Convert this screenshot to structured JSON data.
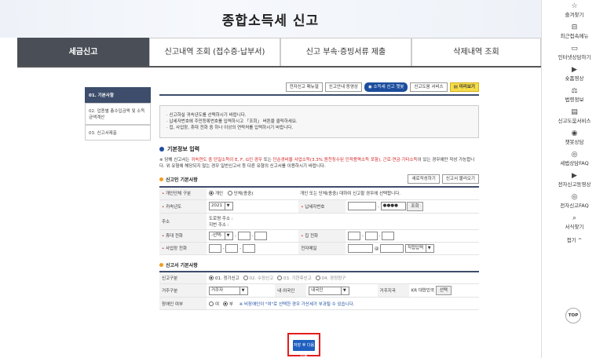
{
  "page": {
    "title": "종합소득세 신고"
  },
  "tabs": [
    {
      "label": "세금신고"
    },
    {
      "label": "신고내역 조회 (접수증·납부서)"
    },
    {
      "label": "신고 부속·증빙서류 제출"
    },
    {
      "label": "삭제내역 조회"
    }
  ],
  "quick": [
    {
      "icon": "star-icon",
      "glyph": "☆",
      "label": "즐겨찾기"
    },
    {
      "icon": "recent-menu-icon",
      "glyph": "⊟",
      "label": "최근접속메뉴"
    },
    {
      "icon": "monitor-icon",
      "glyph": "▭",
      "label": "인터넷상담하기"
    },
    {
      "icon": "video-icon",
      "glyph": "▶",
      "label": "숏폼영상"
    },
    {
      "icon": "law-icon",
      "glyph": "⚖",
      "label": "법령정보"
    },
    {
      "icon": "service-icon",
      "glyph": "▤",
      "label": "신고도움서비스"
    },
    {
      "icon": "chatbot-icon",
      "glyph": "◉",
      "label": "챗봇상담"
    },
    {
      "icon": "faq-icon",
      "glyph": "◎",
      "label": "세법상담FAQ"
    },
    {
      "icon": "video2-icon",
      "glyph": "▶",
      "label": "전자신고동영상"
    },
    {
      "icon": "faq2-icon",
      "glyph": "◎",
      "label": "전자신고FAQ"
    },
    {
      "icon": "search-icon",
      "glyph": "⌕",
      "label": "서식찾기"
    },
    {
      "icon": "fold-icon",
      "glyph": "",
      "label": "접기 ^"
    }
  ],
  "top_label": "TOP",
  "sidenav": [
    {
      "label": "01. 기본사항",
      "active": true
    },
    {
      "label": "02. 업종별 총수입금액 및 소득금액계산",
      "active": false
    },
    {
      "label": "03. 신고서제출",
      "active": false
    }
  ],
  "toolbar": {
    "manual": "전자신고 매뉴얼",
    "guide_video": "신고안내 동영상",
    "chatbot": "소득세 신고 챗봇",
    "help_service": "신고도움 서비스",
    "preview": "미리보기"
  },
  "notice": [
    "· 신고하실 귀속년도를 선택하시기 바랍니다.",
    "· 납세자번호에 주민등록번호를 입력하시고 「조회」 버튼을 클릭하세요.",
    "· 집, 사업장, 휴대 전화 중 하나 이상의 연락처를 입력하시기 바랍니다."
  ],
  "section_basic": "기본정보 입력",
  "warn": {
    "prefix": "※ 당해 신고서는 ",
    "red1": "귀속연도 중 단일소득이 E, F, G인 경우",
    "mid": " 또는 ",
    "red2": "단순경비율 사업소득(3.3% 원천징수된 인적용역소득 포함), 근로·연금·기타소득",
    "suffix": "이 있는 경우에만 작성 가능합니다. 위 유형에 해당되지 않는 경우 일반신고서 등 다른 유형의 신고서를 이용하시기 바랍니다."
  },
  "filer": {
    "heading": "신고인 기본사항",
    "btn_new": "새로작성하기",
    "btn_load": "신고서 불러오기",
    "type_label": "개인단체 구분",
    "type_opt1": "개인",
    "type_opt2": "단체(종중)",
    "type_note": "개인 또는 단체(종중) 대하여 신고할 경우에 선택합니다.",
    "year_label": "귀속년도",
    "year_value": "2021",
    "taxno_label": "납세자번호",
    "taxno_masked": "●●●●",
    "lookup_btn": "조회",
    "addr_label": "주소",
    "addr_road": "도로명 주소 :",
    "addr_lot": "지번 주소 :",
    "mobile_label": "휴대 전화",
    "mobile_select": "-선택-",
    "home_label": "집 전화",
    "biz_label": "사업장 전화",
    "email_label": "전자메일",
    "email_at": "@",
    "email_select": "직접입력"
  },
  "report": {
    "heading": "신고서 기본사항",
    "kind_label": "신고구분",
    "kind_opts": [
      "01. 정기신고",
      "02. 수정신고",
      "03. 기한후신고",
      "04. 경정청구"
    ],
    "resident_label": "거주구분",
    "resident_value": "거주자",
    "nation_label": "내·외국인",
    "nation_value": "내국인",
    "country_label": "거주지국",
    "country_code": "KR",
    "country_name": "대한민국",
    "country_btn": "선택",
    "disabled_label": "장애인 여부",
    "disabled_yes": "여",
    "disabled_no": "부",
    "disabled_hint": "※ 비장애인이 \"여\"로 선택한 경우 가산세가 부과될 수 있습니다."
  },
  "save_button": "저장 후 다음이동"
}
